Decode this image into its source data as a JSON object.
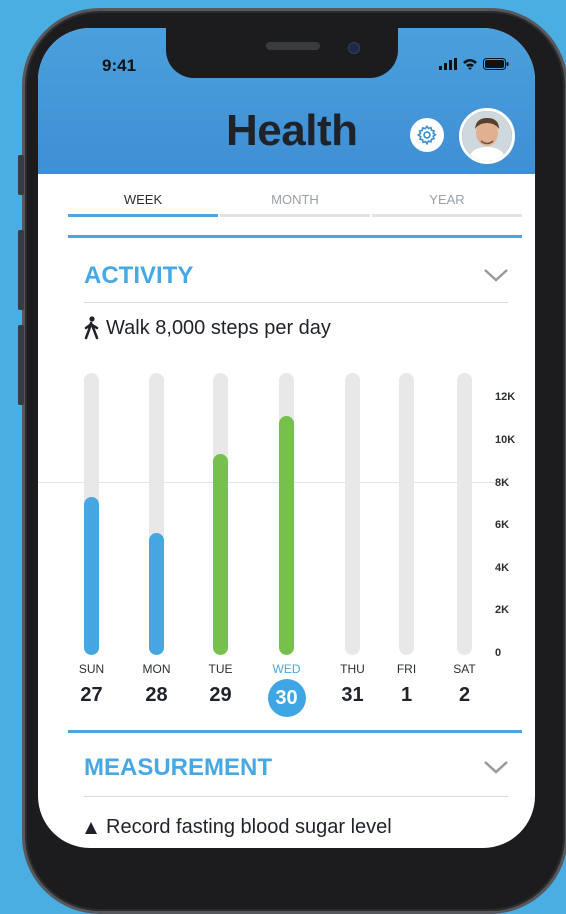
{
  "status_bar": {
    "time": "9:41"
  },
  "header": {
    "title": "Health"
  },
  "tabs": [
    {
      "label": "WEEK",
      "active": true
    },
    {
      "label": "MONTH",
      "active": false
    },
    {
      "label": "YEAR",
      "active": false
    }
  ],
  "activity": {
    "title": "ACTIVITY",
    "goal": "Walk 8,000 steps per day",
    "y_ticks": [
      "12K",
      "10K",
      "8K",
      "6K",
      "4K",
      "2K",
      "0"
    ],
    "days": [
      {
        "day": "SUN",
        "date": "27"
      },
      {
        "day": "MON",
        "date": "28"
      },
      {
        "day": "TUE",
        "date": "29"
      },
      {
        "day": "WED",
        "date": "30"
      },
      {
        "day": "THU",
        "date": "31"
      },
      {
        "day": "FRI",
        "date": "1"
      },
      {
        "day": "SAT",
        "date": "2"
      }
    ]
  },
  "chart_data": {
    "type": "bar",
    "categories": [
      "SUN",
      "MON",
      "TUE",
      "WED",
      "THU",
      "FRI",
      "SAT"
    ],
    "values": [
      7200,
      5500,
      9200,
      11000,
      0,
      0,
      0
    ],
    "ylim": [
      0,
      13000
    ],
    "goal_line": 8000,
    "colors": {
      "below_goal": "#46a6e2",
      "above_goal": "#76c04e",
      "track": "#e8e8e8"
    },
    "selected_index": 3
  },
  "measurement": {
    "title": "MEASUREMENT",
    "record_text": "Record fasting blood sugar level"
  },
  "colors": {
    "accent": "#47a8e6",
    "background": "#4aaee2"
  }
}
